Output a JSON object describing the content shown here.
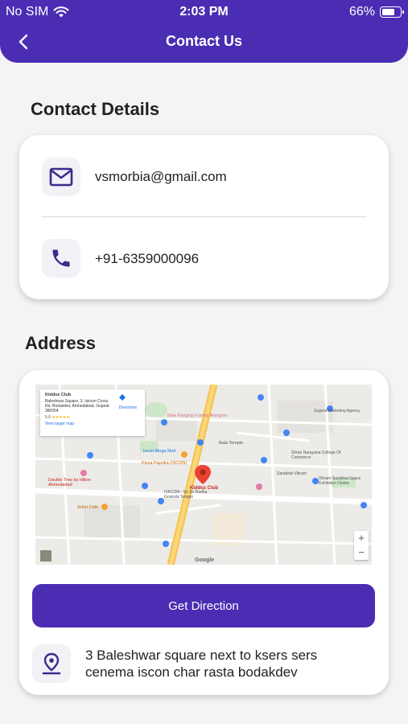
{
  "status_bar": {
    "carrier": "No SIM",
    "time": "2:03 PM",
    "battery": "66%"
  },
  "header": {
    "title": "Contact Us"
  },
  "contact": {
    "section_title": "Contact Details",
    "email": "vsmorbia@gmail.com",
    "phone": "+91-6359000096"
  },
  "address": {
    "section_title": "Address",
    "button_label": "Get Direction",
    "text": "3 Baleshwar square next to ksers sers cenema iscon char rasta bodakdev"
  },
  "map": {
    "place_name": "Kiddoz Club",
    "place_address": "Baleshwar Square, 3, Iskcon Cross Rd, Bodakdev, Ahmedabad, Gujarat 380054",
    "rating": "5.0",
    "stars": "★★★★★",
    "larger_map_link": "View larger map",
    "directions_label": "Directions",
    "pin_label": "Kiddoz Club",
    "attribution": "Google",
    "labels": [
      "New Panghat Farmly Mangroo",
      "Iscon Mega Mall",
      "Pizza Paprika (ISCON)",
      "Bala Temple",
      "ISKCON - Sri Sri Radha Govinda Temple",
      "Double Tree by Hilton Ahmedabad",
      "Arfon Cafe",
      "Vikram Sarabhai Space Exhibition Centre",
      "Shree Narayana College Of Commerce",
      "Gujarat Marketing Agency",
      "Sarabhai Vikram"
    ]
  },
  "colors": {
    "primary": "#4a2db3",
    "background": "#f4f4f6",
    "card": "#ffffff"
  },
  "icons": {
    "back": "chevron-left-icon",
    "email": "mail-icon",
    "phone": "phone-icon",
    "location": "location-pin-icon"
  }
}
